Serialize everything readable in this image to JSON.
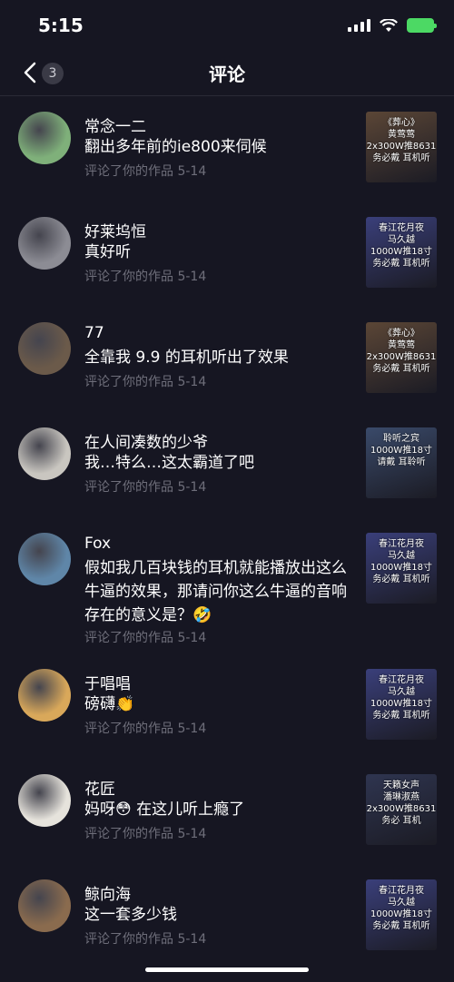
{
  "status": {
    "time": "5:15"
  },
  "nav": {
    "badge": "3",
    "title": "评论"
  },
  "comments": [
    {
      "name": "常念一二",
      "text": "翻出多年前的ie800来伺候",
      "meta": "评论了你的作品  5-14",
      "thumb_text": "《葬心》\n黄莺莺\n2x300W推8631\n务必戴  耳机听",
      "avatar_color": "#7fb07a",
      "thumb_color": "#5b4636"
    },
    {
      "name": "好莱坞恒",
      "text": "真好听",
      "meta": "评论了你的作品  5-14",
      "thumb_text": "春江花月夜\n马久越\n1000W推18寸\n务必戴  耳机听",
      "avatar_color": "#8c8c94",
      "thumb_color": "#3a3f7a"
    },
    {
      "name": "77",
      "text": "全靠我 9.9 的耳机听出了效果",
      "meta": "评论了你的作品  5-14",
      "thumb_text": "《葬心》\n黄莺莺\n2x300W推8631\n务必戴  耳机听",
      "avatar_color": "#6b5a4a",
      "thumb_color": "#5b4636"
    },
    {
      "name": "在人间凑数的少爷",
      "text": "我…特么…这太霸道了吧",
      "meta": "评论了你的作品  5-14",
      "thumb_text": "聆听之宾\n1000W推18寸\n请戴  耳聆听",
      "avatar_color": "#c9c6c0",
      "thumb_color": "#3a4a6a"
    },
    {
      "name": "Fox",
      "text": "假如我几百块钱的耳机就能播放出这么牛逼的效果，那请问你这么牛逼的音响存在的意义是？🤣",
      "meta": "评论了你的作品  5-14",
      "thumb_text": "春江花月夜\n马久越\n1000W推18寸\n务必戴  耳机听",
      "avatar_color": "#5f86a8",
      "thumb_color": "#3a3f7a"
    },
    {
      "name": "于唱唱",
      "text": "磅礴👏",
      "meta": "评论了你的作品  5-14",
      "thumb_text": "春江花月夜\n马久越\n1000W推18寸\n务必戴  耳机听",
      "avatar_color": "#d9a85a",
      "thumb_color": "#3a3f7a"
    },
    {
      "name": "花匠",
      "text": "妈呀😳 在这儿听上瘾了",
      "meta": "评论了你的作品  5-14",
      "thumb_text": "天籁女声\n潘琳淑燕\n2x300W推8631\n务必   耳机",
      "avatar_color": "#e6e3dc",
      "thumb_color": "#2f3550"
    },
    {
      "name": "鲸向海",
      "text": "这一套多少钱",
      "meta": "评论了你的作品  5-14",
      "thumb_text": "春江花月夜\n马久越\n1000W推18寸\n务必戴  耳机听",
      "avatar_color": "#8a6b4e",
      "thumb_color": "#3a3f7a"
    }
  ]
}
